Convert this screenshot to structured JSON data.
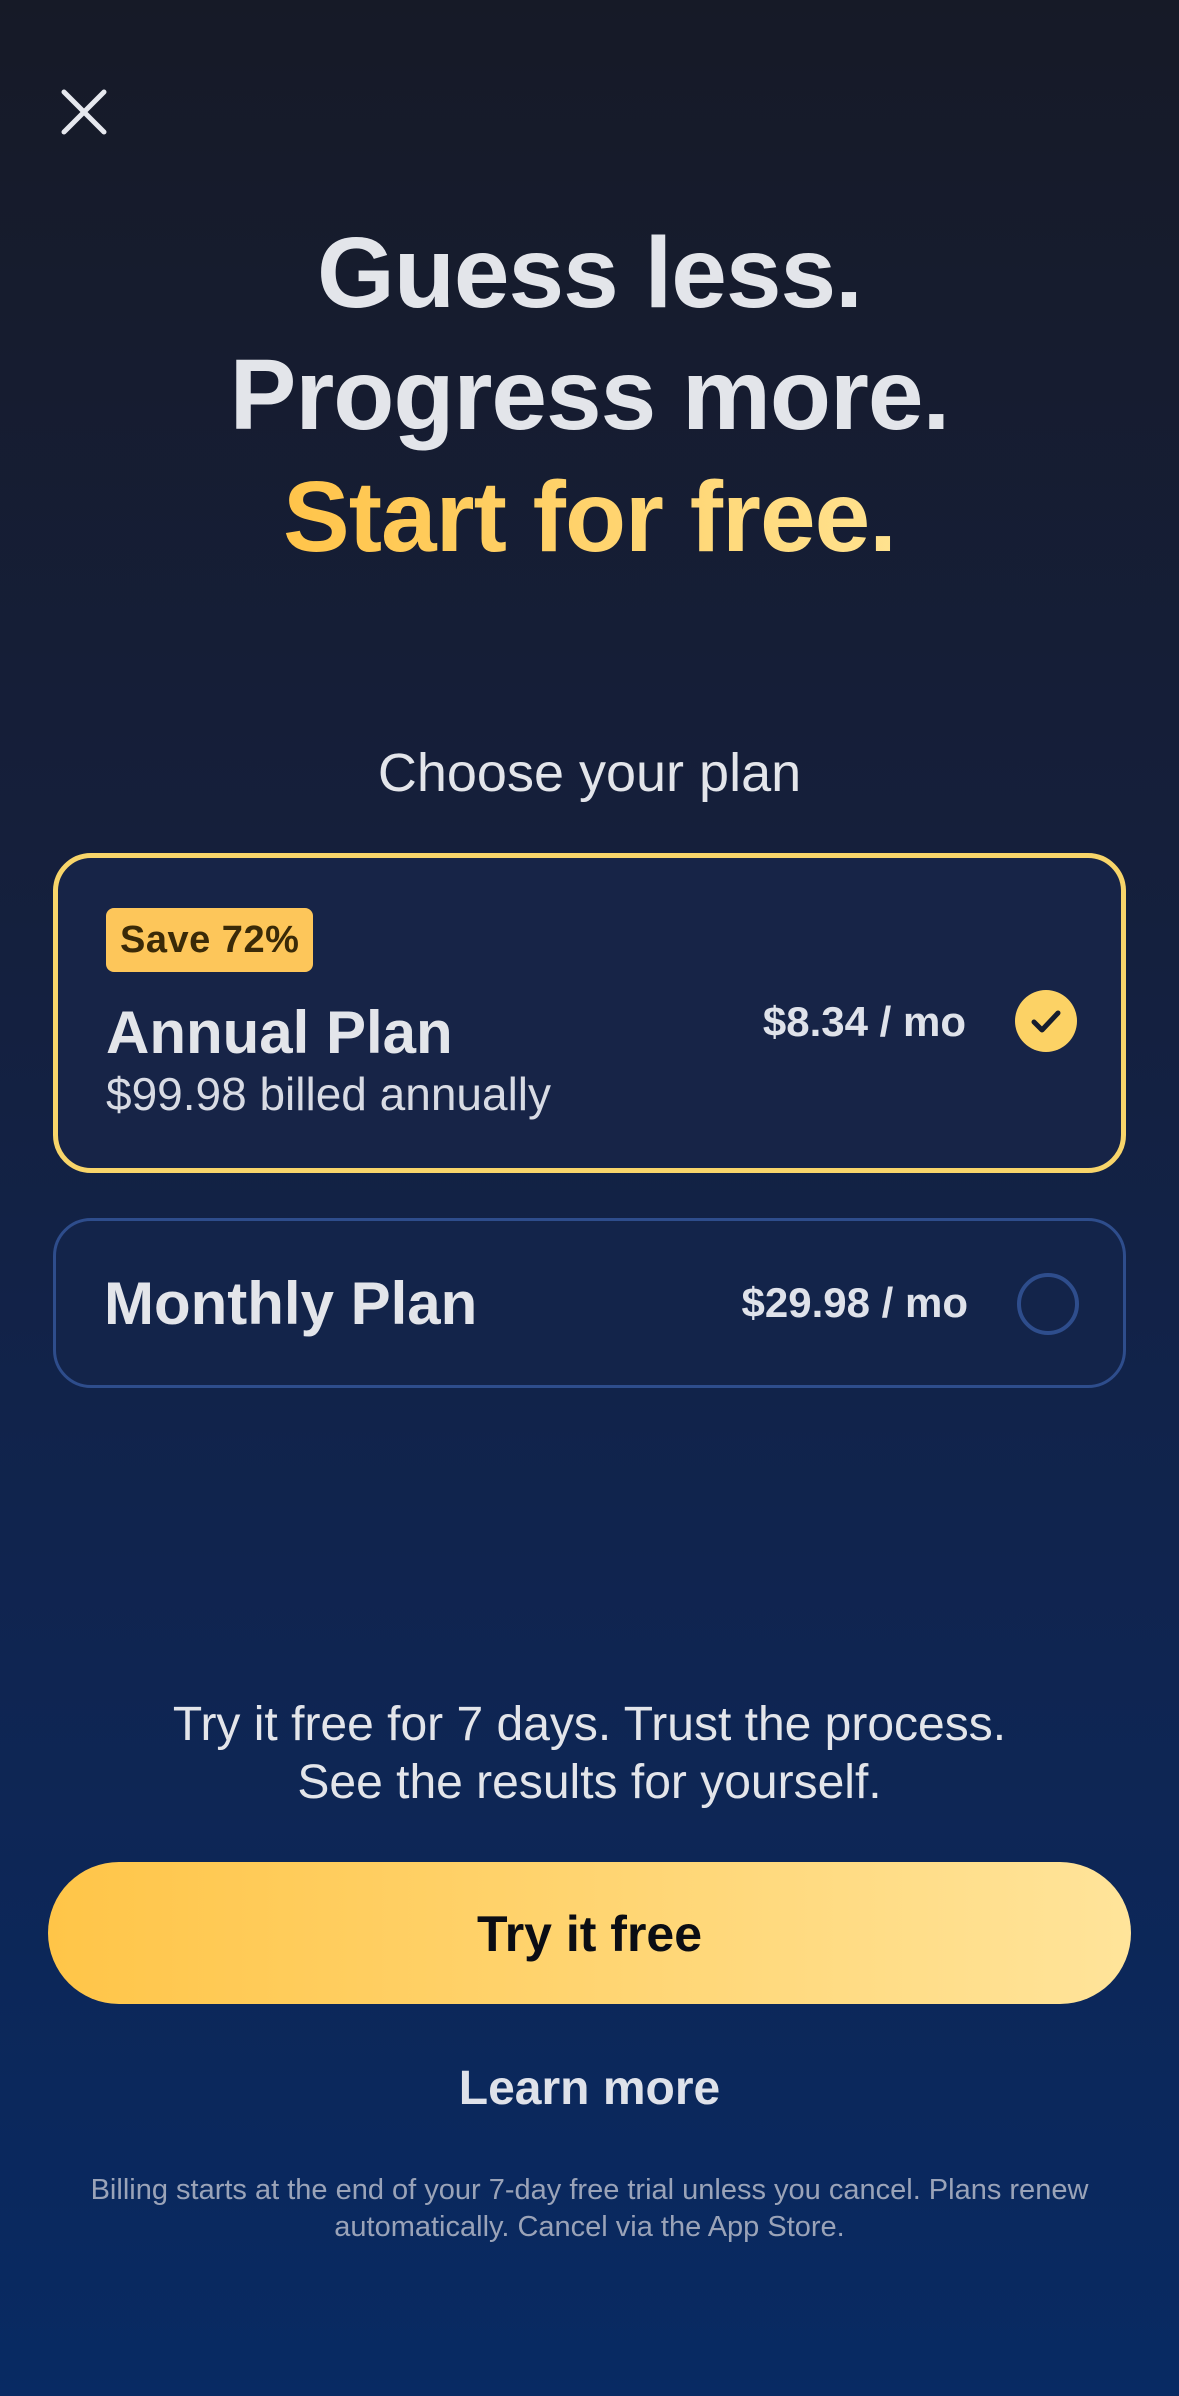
{
  "close": {
    "icon": "close-icon"
  },
  "headline": {
    "line1": "Guess less.",
    "line2": "Progress more.",
    "line3": "Start for free."
  },
  "plans_section": {
    "title": "Choose your plan"
  },
  "plans": {
    "annual": {
      "badge": "Save 72%",
      "name": "Annual Plan",
      "subtitle": "$99.98 billed annually",
      "price": "$8.34 / mo",
      "selected": true
    },
    "monthly": {
      "name": "Monthly Plan",
      "price": "$29.98 / mo",
      "selected": false
    }
  },
  "trial": {
    "line1": "Try it free for 7 days. Trust the process.",
    "line2": "See the results for yourself."
  },
  "cta": {
    "label": "Try it free"
  },
  "learn_more": {
    "label": "Learn more"
  },
  "legal": {
    "text": "Billing starts at the end of your 7-day free trial unless you cancel. Plans renew automatically. Cancel via the App Store."
  },
  "colors": {
    "accent": "#fcd265",
    "card_border_selected": "#f8d56a",
    "card_border": "#2e4d8c",
    "background_top": "#161a27",
    "background_bottom": "#082a63"
  }
}
